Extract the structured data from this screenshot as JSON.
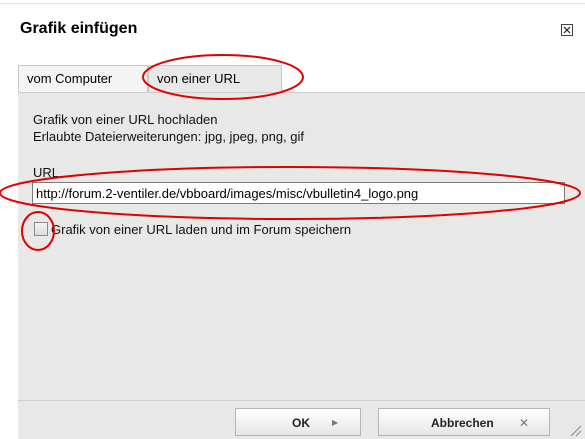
{
  "dialog": {
    "title": "Grafik einfügen",
    "close_icon": "close-icon"
  },
  "tabs": [
    {
      "label": "vom Computer",
      "active": false
    },
    {
      "label": "von einer URL",
      "active": true
    }
  ],
  "panel": {
    "description_line1": "Grafik von einer URL hochladen",
    "description_line2": "Erlaubte Dateierweiterungen: jpg, jpeg, png, gif",
    "url_label": "URL",
    "url_value": "http://forum.2-ventiler.de/vbboard/images/misc/vbulletin4_logo.png",
    "checkbox_label": "Grafik von einer URL laden und im Forum speichern",
    "checkbox_checked": false
  },
  "footer": {
    "ok_label": "OK",
    "cancel_label": "Abbrechen",
    "ok_icon": "play-arrow-icon",
    "cancel_icon": "x-icon"
  },
  "annotations": {
    "color": "#e00000"
  }
}
